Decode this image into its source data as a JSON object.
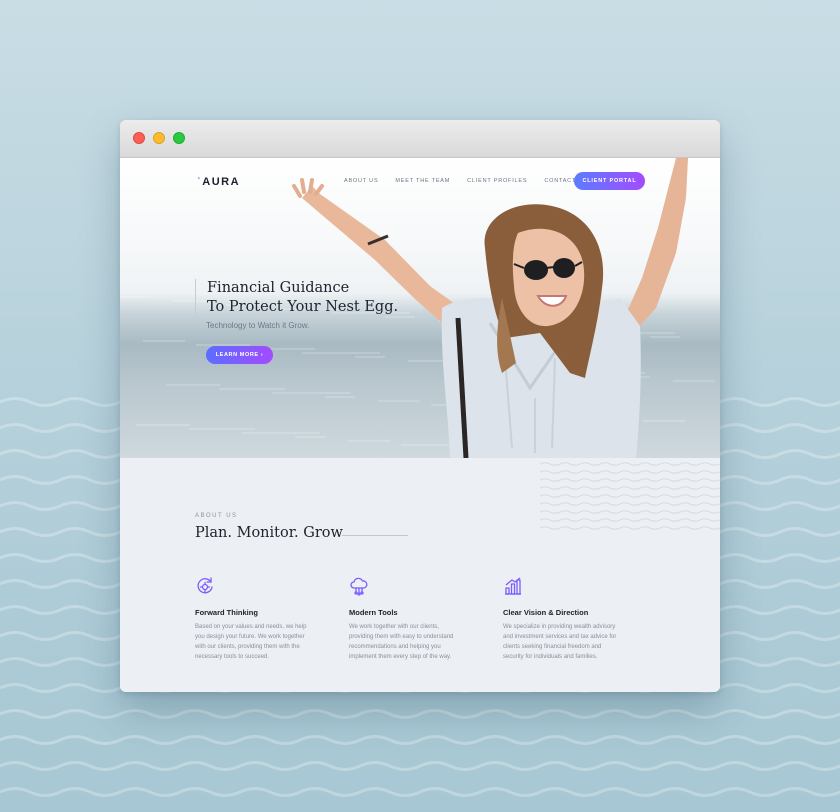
{
  "colors": {
    "accent_start": "#5b7cff",
    "accent_end": "#a44cff",
    "icon": "#7b5cff",
    "heading": "#20232e"
  },
  "nav": {
    "logo": "AURA",
    "links": [
      "ABOUT US",
      "MEET THE TEAM",
      "CLIENT PROFILES",
      "CONTACT US"
    ],
    "portal": "CLIENT PORTAL"
  },
  "hero": {
    "title_line1": "Financial Guidance",
    "title_line2": "To Protect Your Nest Egg.",
    "subtitle": "Technology to Watch it Grow.",
    "cta": "LEARN MORE ›"
  },
  "about": {
    "kicker": "ABOUT US",
    "title": "Plan. Monitor. Grow",
    "features": [
      {
        "icon": "refresh-gear-icon",
        "name": "Forward Thinking",
        "desc": "Based on your values and needs, we help you design your future. We work together with our clients, providing them with the necessary tools to succeed."
      },
      {
        "icon": "cloud-network-icon",
        "name": "Modern Tools",
        "desc": "We work together with our clients, providing them with easy to understand recommendations and helping you implement them every step of the way."
      },
      {
        "icon": "bar-chart-icon",
        "name": "Clear Vision & Direction",
        "desc": "We specialize in providing wealth advisory and investment services and tax advice for clients seeking financial freedom and security for individuals and families."
      }
    ]
  }
}
